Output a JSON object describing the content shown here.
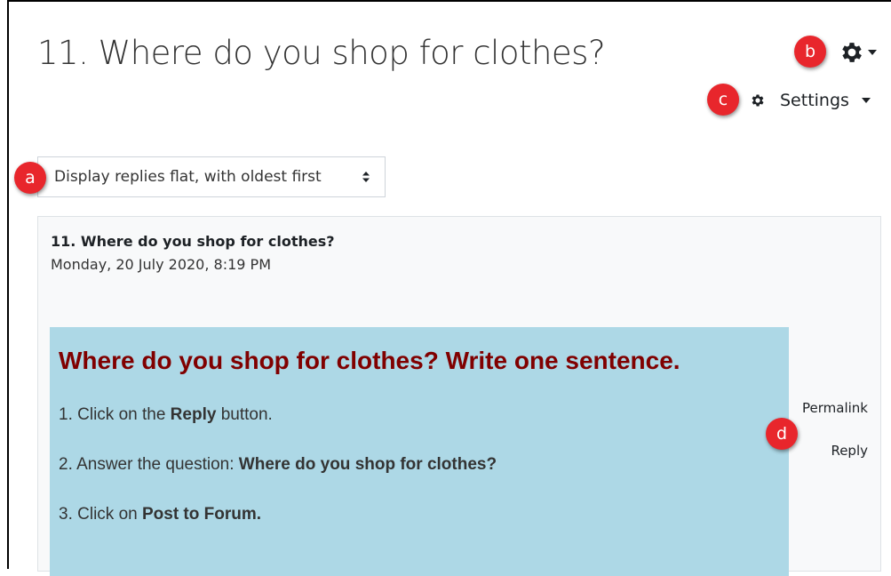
{
  "page": {
    "title": "11. Where do you shop for clothes?"
  },
  "markers": {
    "a": "a",
    "b": "b",
    "c": "c",
    "d": "d"
  },
  "menus": {
    "gear_icon": "gear-icon",
    "settings_label": "Settings"
  },
  "display_mode": {
    "selected": "Display replies flat, with oldest first"
  },
  "post": {
    "subject": "11. Where do you shop for clothes?",
    "date": "Monday, 20 July 2020, 8:19 PM",
    "heading": "Where do you shop for clothes? Write one sentence.",
    "steps": [
      {
        "prefix": "1. Click on the ",
        "bold": "Reply",
        "suffix": " button."
      },
      {
        "prefix": "2. Answer the question: ",
        "bold": "Where do you shop for clothes?",
        "suffix": ""
      },
      {
        "prefix": "3. Click on ",
        "bold": "Post to Forum.",
        "suffix": ""
      }
    ],
    "links": {
      "permalink": "Permalink",
      "reply": "Reply"
    }
  },
  "colors": {
    "marker": "#e8262c",
    "content_background": "#add8e6",
    "heading": "#800000"
  }
}
